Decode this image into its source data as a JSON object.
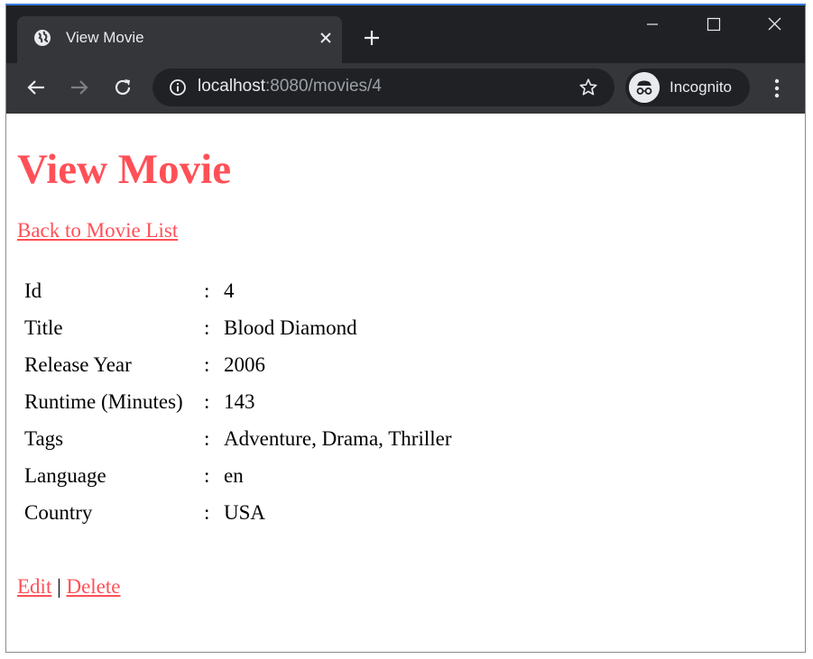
{
  "browser": {
    "tab_title": "View Movie",
    "url_host": "localhost",
    "url_rest": ":8080/movies/4",
    "profile_label": "Incognito"
  },
  "page": {
    "title": "View Movie",
    "back_link": "Back to Movie List",
    "separator": ":",
    "fields": [
      {
        "label": "Id",
        "value": "4"
      },
      {
        "label": "Title",
        "value": "Blood Diamond"
      },
      {
        "label": "Release Year",
        "value": "2006"
      },
      {
        "label": "Runtime (Minutes)",
        "value": "143"
      },
      {
        "label": "Tags",
        "value": "Adventure, Drama, Thriller"
      },
      {
        "label": "Language",
        "value": "en"
      },
      {
        "label": "Country",
        "value": "USA"
      }
    ],
    "edit_link": "Edit",
    "action_divider": "|",
    "delete_link": "Delete"
  },
  "colors": {
    "accent": "#ff5057",
    "chrome_dark": "#202124",
    "chrome_mid": "#35363a"
  }
}
